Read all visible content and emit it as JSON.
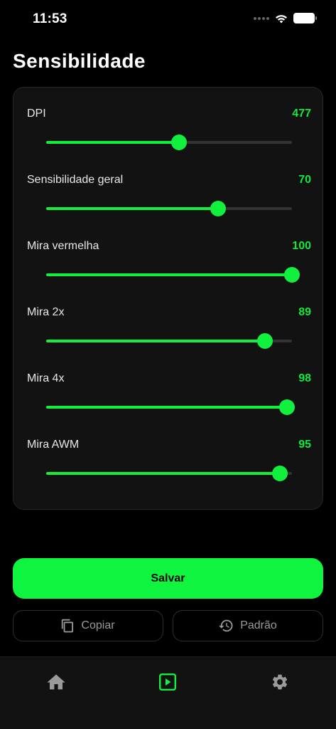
{
  "status_bar": {
    "time": "11:53"
  },
  "page": {
    "title": "Sensibilidade"
  },
  "sliders": [
    {
      "label": "DPI",
      "value": "477",
      "fill_fraction": 0.54
    },
    {
      "label": "Sensibilidade geral",
      "value": "70",
      "fill_fraction": 0.7
    },
    {
      "label": "Mira vermelha",
      "value": "100",
      "fill_fraction": 1.0
    },
    {
      "label": "Mira 2x",
      "value": "89",
      "fill_fraction": 0.89
    },
    {
      "label": "Mira 4x",
      "value": "98",
      "fill_fraction": 0.98
    },
    {
      "label": "Mira AWM",
      "value": "95",
      "fill_fraction": 0.95
    }
  ],
  "actions": {
    "save_label": "Salvar",
    "copy_label": "Copiar",
    "reset_label": "Padrão"
  },
  "icons": {
    "copy": "copy-icon",
    "reset": "history-icon",
    "home": "home-icon",
    "play": "play-icon",
    "settings": "gear-icon"
  },
  "colors": {
    "accent": "#12f03e",
    "background": "#000000",
    "card": "#121212",
    "track": "#333333",
    "muted_text": "#9a9a9a"
  }
}
